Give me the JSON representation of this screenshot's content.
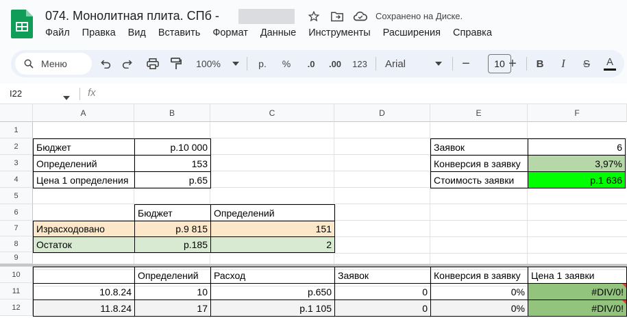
{
  "doc": {
    "title": "074. Монолитная плита. СПб -",
    "saved": "Сохранено на Диске."
  },
  "menu": [
    "Файл",
    "Правка",
    "Вид",
    "Вставить",
    "Формат",
    "Данные",
    "Инструменты",
    "Расширения",
    "Справка"
  ],
  "toolbar": {
    "search": "Меню",
    "zoom": "100%",
    "currency": "р.",
    "percent": "%",
    "dec_less": ".0",
    "dec_more": ".00",
    "num_format": "123",
    "font": "Arial",
    "font_size": "10",
    "minus": "−",
    "plus": "+",
    "bold": "B",
    "italic": "I",
    "strike": "S",
    "textcolor": "A"
  },
  "formula_bar": {
    "cell_ref": "I22",
    "fx": "fx"
  },
  "columns": [
    "A",
    "B",
    "C",
    "D",
    "E",
    "F"
  ],
  "rows": [
    "1",
    "2",
    "3",
    "4",
    "5",
    "6",
    "7",
    "8",
    "9",
    "10",
    "11",
    "12"
  ],
  "cells": {
    "A2": "Бюджет",
    "B2": "р.10 000",
    "A3": "Определений",
    "B3": "153",
    "A4": "Цена 1 определения",
    "B4": "р.65",
    "E2": "Заявок",
    "F2": "6",
    "E3": "Конверсия в заявку",
    "F3": "3,97%",
    "E4": "Стоимость заявки",
    "F4": "р.1 636",
    "B6": "Бюджет",
    "C6": "Определений",
    "A7": "Израсходовано",
    "B7": "р.9 815",
    "C7": "151",
    "A8": "Остаток",
    "B8": "р.185",
    "C8": "2",
    "B10": "Определений",
    "C10": "Расход",
    "D10": "Заявок",
    "E10": "Конверсия в заявку",
    "F10": "Цена 1 заявки",
    "A11": "10.8.24",
    "B11": "10",
    "C11": "р.650",
    "D11": "0",
    "E11": "0%",
    "F11": "#DIV/0!",
    "A12": "11.8.24",
    "B12": "17",
    "C12": "р.1 105",
    "D12": "0",
    "E12": "0%",
    "F12": "#DIV/0!"
  },
  "colors": {
    "accent_green": "#188038",
    "light_green": "#d9ead3",
    "bright_green": "#00ff00",
    "light_orange": "#fce8c9",
    "mid_green": "#93c47d"
  }
}
